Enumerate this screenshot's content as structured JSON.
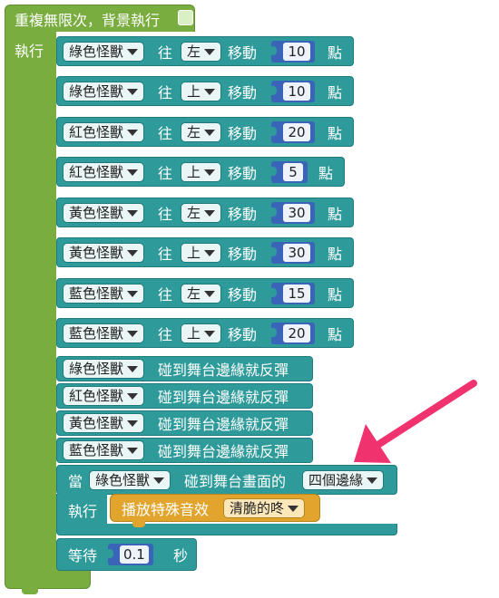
{
  "loop": {
    "title": "重複無限次，背景執行",
    "exec_label": "執行"
  },
  "labels": {
    "toward": "往",
    "move": "移動",
    "points": "點",
    "touch_edge": "碰到舞台邊緣就反彈",
    "when": "當",
    "touch_stage": "碰到舞台畫面的",
    "exec": "執行",
    "play_sound": "播放特殊音效",
    "wait": "等待",
    "seconds": "秒"
  },
  "move_blocks": [
    {
      "sprite": "綠色怪獸",
      "dir": "左",
      "value": "10"
    },
    {
      "sprite": "綠色怪獸",
      "dir": "上",
      "value": "10"
    },
    {
      "sprite": "紅色怪獸",
      "dir": "左",
      "value": "20"
    },
    {
      "sprite": "紅色怪獸",
      "dir": "上",
      "value": "5"
    },
    {
      "sprite": "黃色怪獸",
      "dir": "左",
      "value": "30"
    },
    {
      "sprite": "黃色怪獸",
      "dir": "上",
      "value": "30"
    },
    {
      "sprite": "藍色怪獸",
      "dir": "左",
      "value": "15"
    },
    {
      "sprite": "藍色怪獸",
      "dir": "上",
      "value": "20"
    }
  ],
  "bounce_blocks": [
    {
      "sprite": "綠色怪獸"
    },
    {
      "sprite": "紅色怪獸"
    },
    {
      "sprite": "黃色怪獸"
    },
    {
      "sprite": "藍色怪獸"
    }
  ],
  "when_block": {
    "sprite": "綠色怪獸",
    "edges": "四個邊緣"
  },
  "sound_block": {
    "sound": "清脆的咚"
  },
  "wait_block": {
    "value": "0.1"
  },
  "colors": {
    "loop_green": "#7aad3f",
    "block_teal": "#2e9a9a",
    "number_blue": "#3a64b8",
    "sound_orange": "#e1a42c",
    "arrow_pink": "#f0336f"
  }
}
